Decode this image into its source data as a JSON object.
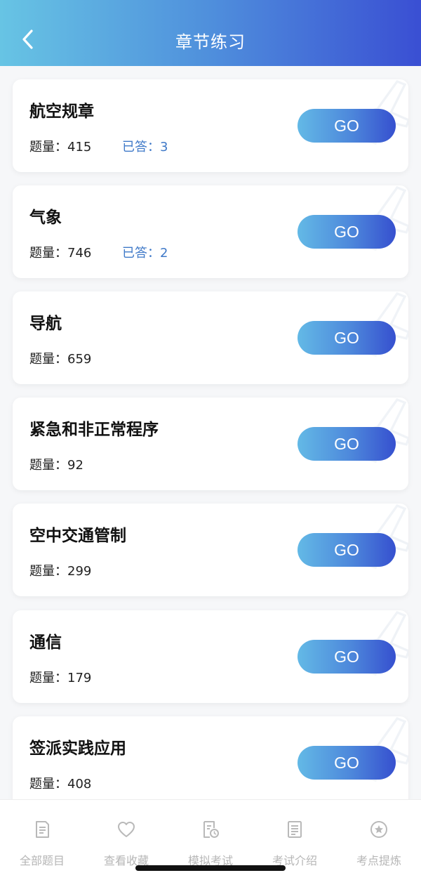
{
  "header": {
    "title": "章节练习"
  },
  "colors": {
    "accent": "#3f79c8",
    "header_start": "#67c4e4",
    "header_end": "#3a4fd3"
  },
  "chapters": [
    {
      "title": "航空规章",
      "count_label": "题量：",
      "count": "415",
      "answered_label": "已答：",
      "answered": "3",
      "go_label": "GO"
    },
    {
      "title": "气象",
      "count_label": "题量：",
      "count": "746",
      "answered_label": "已答：",
      "answered": "2",
      "go_label": "GO"
    },
    {
      "title": "导航",
      "count_label": "题量：",
      "count": "659",
      "go_label": "GO"
    },
    {
      "title": "紧急和非正常程序",
      "count_label": "题量：",
      "count": "92",
      "go_label": "GO"
    },
    {
      "title": "空中交通管制",
      "count_label": "题量：",
      "count": "299",
      "go_label": "GO"
    },
    {
      "title": "通信",
      "count_label": "题量：",
      "count": "179",
      "go_label": "GO"
    },
    {
      "title": "签派实践应用",
      "count_label": "题量：",
      "count": "408",
      "go_label": "GO"
    }
  ],
  "tabbar": {
    "items": [
      {
        "label": "全部题目",
        "icon": "document-icon"
      },
      {
        "label": "查看收藏",
        "icon": "heart-icon"
      },
      {
        "label": "模拟考试",
        "icon": "exam-clock-icon"
      },
      {
        "label": "考试介绍",
        "icon": "list-document-icon"
      },
      {
        "label": "考点提炼",
        "icon": "star-circle-icon"
      }
    ]
  }
}
